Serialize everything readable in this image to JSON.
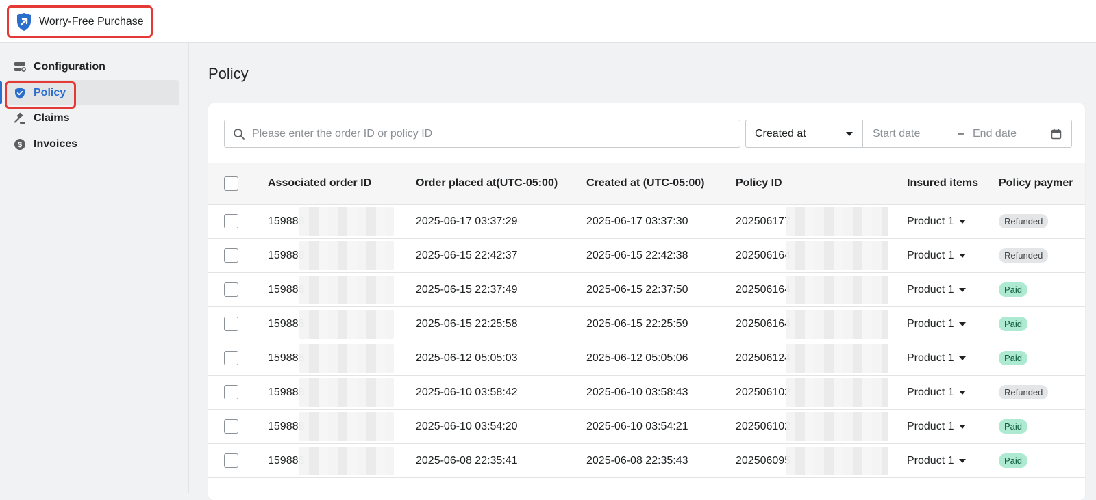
{
  "app": {
    "title": "Worry-Free Purchase",
    "accent_color": "#2c6ecb",
    "highlight_color": "#e53935"
  },
  "sidebar": {
    "items": [
      {
        "label": "Configuration",
        "icon": "configuration-icon",
        "active": false
      },
      {
        "label": "Policy",
        "icon": "shield-check-icon",
        "active": true
      },
      {
        "label": "Claims",
        "icon": "gavel-icon",
        "active": false
      },
      {
        "label": "Invoices",
        "icon": "dollar-circle-icon",
        "active": false
      }
    ]
  },
  "page": {
    "title": "Policy"
  },
  "filters": {
    "search_placeholder": "Please enter the order ID or policy ID",
    "search_value": "",
    "date_type": "Created at",
    "start_placeholder": "Start date",
    "range_separator": "–",
    "end_placeholder": "End date"
  },
  "table": {
    "columns": [
      "Associated order ID",
      "Order placed at(UTC-05:00)",
      "Created at (UTC-05:00)",
      "Policy ID",
      "Insured items",
      "Policy paymer"
    ],
    "rows": [
      {
        "order_id": "159888",
        "placed": "2025-06-17 03:37:29",
        "created": "2025-06-17 03:37:30",
        "policy_id": "202506177",
        "item": "Product 1",
        "status": "Refunded"
      },
      {
        "order_id": "159888",
        "placed": "2025-06-15 22:42:37",
        "created": "2025-06-15 22:42:38",
        "policy_id": "202506164",
        "item": "Product 1",
        "status": "Refunded"
      },
      {
        "order_id": "159888",
        "placed": "2025-06-15 22:37:49",
        "created": "2025-06-15 22:37:50",
        "policy_id": "202506164",
        "item": "Product 1",
        "status": "Paid"
      },
      {
        "order_id": "159888",
        "placed": "2025-06-15 22:25:58",
        "created": "2025-06-15 22:25:59",
        "policy_id": "202506164",
        "item": "Product 1",
        "status": "Paid"
      },
      {
        "order_id": "159888",
        "placed": "2025-06-12 05:05:03",
        "created": "2025-06-12 05:05:06",
        "policy_id": "202506124",
        "item": "Product 1",
        "status": "Paid"
      },
      {
        "order_id": "159888",
        "placed": "2025-06-10 03:58:42",
        "created": "2025-06-10 03:58:43",
        "policy_id": "202506102",
        "item": "Product 1",
        "status": "Refunded"
      },
      {
        "order_id": "159888",
        "placed": "2025-06-10 03:54:20",
        "created": "2025-06-10 03:54:21",
        "policy_id": "202506102",
        "item": "Product 1",
        "status": "Paid"
      },
      {
        "order_id": "159888",
        "placed": "2025-06-08 22:35:41",
        "created": "2025-06-08 22:35:43",
        "policy_id": "202506095",
        "item": "Product 1",
        "status": "Paid"
      }
    ]
  }
}
